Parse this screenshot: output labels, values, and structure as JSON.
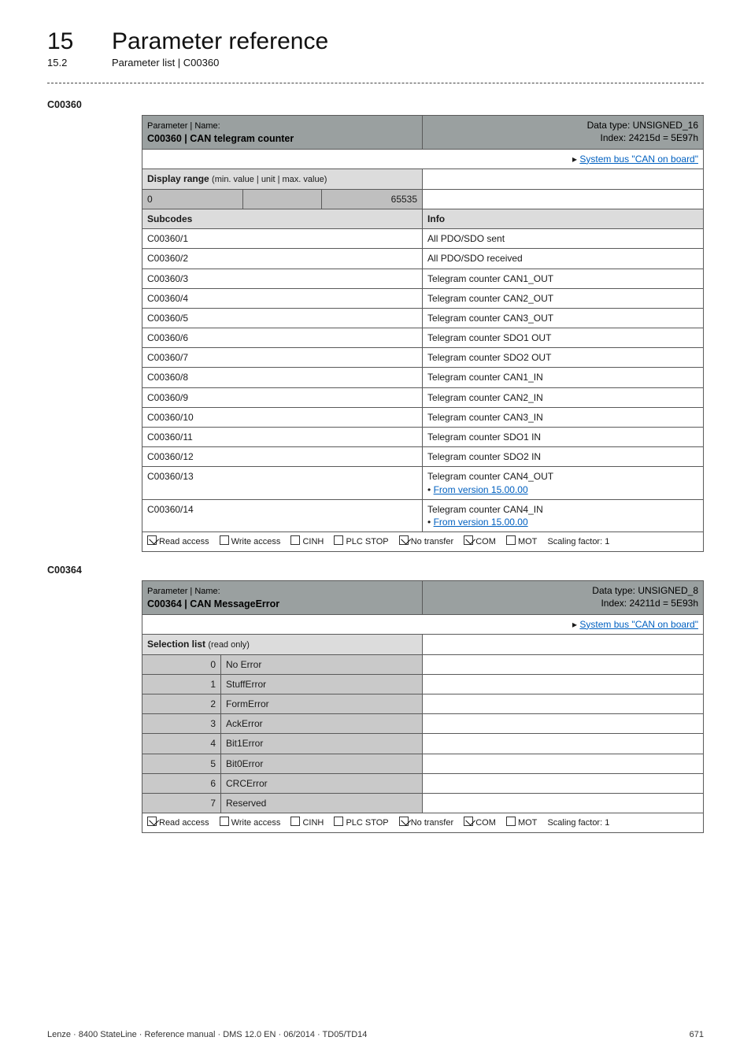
{
  "header": {
    "chapter_num": "15",
    "chapter_title": "Parameter reference",
    "section_num": "15.2",
    "section_title": "Parameter list | C00360"
  },
  "anchor1": "C00360",
  "table1": {
    "hdr_name_label": "Parameter | Name:",
    "hdr_name_value": "C00360 | CAN telegram counter",
    "hdr_data_type": "Data type: UNSIGNED_16",
    "hdr_index": "Index: 24215d = 5E97h",
    "syslink_prefix": "▸ ",
    "syslink": "System bus \"CAN on board\"",
    "disp_range_label": "Display range",
    "disp_range_sub": "(min. value | unit | max. value)",
    "disp_min": "0",
    "disp_max": "65535",
    "subcodes_label": "Subcodes",
    "info_label": "Info",
    "rows": [
      {
        "code": "C00360/1",
        "info": "All PDO/SDO sent"
      },
      {
        "code": "C00360/2",
        "info": "All PDO/SDO received"
      },
      {
        "code": "C00360/3",
        "info": "Telegram counter CAN1_OUT"
      },
      {
        "code": "C00360/4",
        "info": "Telegram counter CAN2_OUT"
      },
      {
        "code": "C00360/5",
        "info": "Telegram counter CAN3_OUT"
      },
      {
        "code": "C00360/6",
        "info": "Telegram counter SDO1 OUT"
      },
      {
        "code": "C00360/7",
        "info": "Telegram counter SDO2 OUT"
      },
      {
        "code": "C00360/8",
        "info": "Telegram counter CAN1_IN"
      },
      {
        "code": "C00360/9",
        "info": "Telegram counter CAN2_IN"
      },
      {
        "code": "C00360/10",
        "info": "Telegram counter CAN3_IN"
      },
      {
        "code": "C00360/11",
        "info": "Telegram counter SDO1 IN"
      },
      {
        "code": "C00360/12",
        "info": "Telegram counter SDO2 IN"
      },
      {
        "code": "C00360/13",
        "info": "Telegram counter CAN4_OUT",
        "fromver": "From version 15.00.00"
      },
      {
        "code": "C00360/14",
        "info": "Telegram counter CAN4_IN",
        "fromver": "From version 15.00.00"
      }
    ],
    "access": {
      "read": "Read access",
      "write": "Write access",
      "cinh": "CINH",
      "plcstop": "PLC STOP",
      "notransfer": "No transfer",
      "com": "COM",
      "mot": "MOT",
      "scaling": "Scaling factor: 1"
    }
  },
  "anchor2": "C00364",
  "table2": {
    "hdr_name_label": "Parameter | Name:",
    "hdr_name_value": "C00364 | CAN MessageError",
    "hdr_data_type": "Data type: UNSIGNED_8",
    "hdr_index": "Index: 24211d = 5E93h",
    "syslink_prefix": "▸ ",
    "syslink": "System bus \"CAN on board\"",
    "sel_list_label": "Selection list",
    "sel_list_sub": "(read only)",
    "rows": [
      {
        "num": "0",
        "label": "No Error"
      },
      {
        "num": "1",
        "label": "StuffError"
      },
      {
        "num": "2",
        "label": "FormError"
      },
      {
        "num": "3",
        "label": "AckError"
      },
      {
        "num": "4",
        "label": "Bit1Error"
      },
      {
        "num": "5",
        "label": "Bit0Error"
      },
      {
        "num": "6",
        "label": "CRCError"
      },
      {
        "num": "7",
        "label": "Reserved"
      }
    ],
    "access": {
      "read": "Read access",
      "write": "Write access",
      "cinh": "CINH",
      "plcstop": "PLC STOP",
      "notransfer": "No transfer",
      "com": "COM",
      "mot": "MOT",
      "scaling": "Scaling factor: 1"
    }
  },
  "footer": {
    "left": "Lenze · 8400 StateLine · Reference manual · DMS 12.0 EN · 06/2014 · TD05/TD14",
    "right": "671"
  }
}
